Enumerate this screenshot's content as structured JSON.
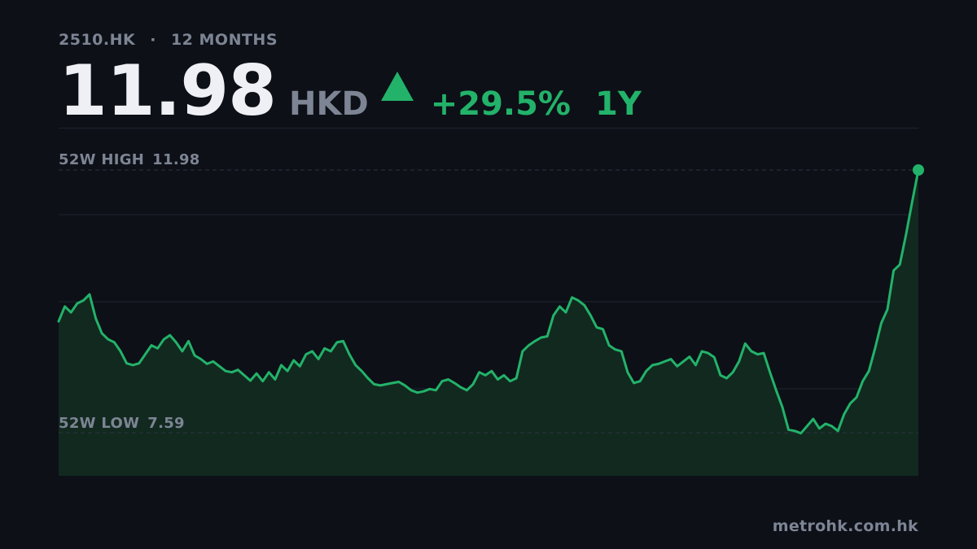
{
  "header": {
    "ticker": "2510.HK",
    "separator": "·",
    "range": "12 MONTHS",
    "price": "11.98",
    "currency": "HKD",
    "change": "+29.5%",
    "period": "1Y"
  },
  "labels": {
    "high_label": "52W HIGH",
    "high_value": "11.98",
    "low_label": "52W LOW",
    "low_value": "7.59"
  },
  "footer": {
    "source": "metrohk.com.hk"
  },
  "colors": {
    "background": "#0d1017",
    "line": "#23b26a",
    "area": "#12291f",
    "grid": "#1f2430",
    "muted_text": "#7d8594",
    "price_text": "#eef0f5"
  },
  "chart_data": {
    "type": "area",
    "high": 11.98,
    "low": 7.59,
    "ylim": [
      7.0,
      12.0
    ],
    "grid": true,
    "end_marker": true,
    "series": [
      {
        "values": [
          9.45,
          9.7,
          9.6,
          9.75,
          9.8,
          9.9,
          9.5,
          9.25,
          9.15,
          9.1,
          8.95,
          8.75,
          8.72,
          8.75,
          8.9,
          9.05,
          9.0,
          9.15,
          9.22,
          9.1,
          8.95,
          9.12,
          8.88,
          8.82,
          8.74,
          8.78,
          8.7,
          8.62,
          8.6,
          8.64,
          8.55,
          8.46,
          8.58,
          8.45,
          8.6,
          8.48,
          8.72,
          8.62,
          8.8,
          8.7,
          8.9,
          8.95,
          8.82,
          9.0,
          8.95,
          9.1,
          9.12,
          8.9,
          8.72,
          8.62,
          8.5,
          8.4,
          8.38,
          8.4,
          8.42,
          8.44,
          8.38,
          8.3,
          8.26,
          8.28,
          8.32,
          8.3,
          8.45,
          8.48,
          8.42,
          8.35,
          8.3,
          8.4,
          8.6,
          8.55,
          8.62,
          8.48,
          8.55,
          8.45,
          8.5,
          8.95,
          9.05,
          9.12,
          9.18,
          9.2,
          9.55,
          9.7,
          9.6,
          9.85,
          9.8,
          9.72,
          9.55,
          9.35,
          9.32,
          9.05,
          8.98,
          8.95,
          8.6,
          8.42,
          8.45,
          8.62,
          8.72,
          8.74,
          8.78,
          8.82,
          8.7,
          8.78,
          8.86,
          8.72,
          8.95,
          8.92,
          8.85,
          8.55,
          8.5,
          8.6,
          8.78,
          9.08,
          8.95,
          8.9,
          8.92,
          8.6,
          8.3,
          8.02,
          7.64,
          7.62,
          7.58,
          7.7,
          7.82,
          7.66,
          7.74,
          7.7,
          7.62,
          7.9,
          8.08,
          8.18,
          8.45,
          8.62,
          9.0,
          9.42,
          9.65,
          10.3,
          10.4,
          10.9,
          11.45,
          11.98
        ]
      }
    ]
  }
}
